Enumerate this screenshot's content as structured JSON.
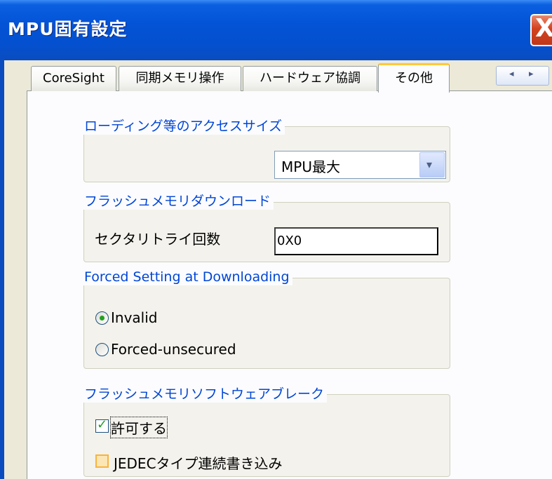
{
  "window": {
    "title": "MPU固有設定",
    "close_glyph": "X"
  },
  "tabs": [
    {
      "label": "CoreSight",
      "active": false
    },
    {
      "label": "同期メモリ操作",
      "active": false
    },
    {
      "label": "ハードウェア協調",
      "active": false
    },
    {
      "label": "その他",
      "active": true
    }
  ],
  "tab_scroll": {
    "left": "◂",
    "right": "▸"
  },
  "groups": {
    "access_size": {
      "title": "ローディング等のアクセスサイズ",
      "select_value": "MPU最大",
      "select_arrow": "▾"
    },
    "flash_download": {
      "title": "フラッシュメモリダウンロード",
      "retry_label": "セクタリトライ回数",
      "retry_value": "0X0"
    },
    "forced_setting": {
      "title": "Forced Setting at Downloading",
      "options": [
        {
          "label": "Invalid",
          "selected": true
        },
        {
          "label": "Forced-unsecured",
          "selected": false
        }
      ]
    },
    "software_break": {
      "title": "フラッシュメモリソフトウェアブレーク",
      "checks": [
        {
          "label": "許可する",
          "checked": true
        },
        {
          "label": "JEDECタイプ連続書き込み",
          "checked": false
        }
      ]
    }
  }
}
